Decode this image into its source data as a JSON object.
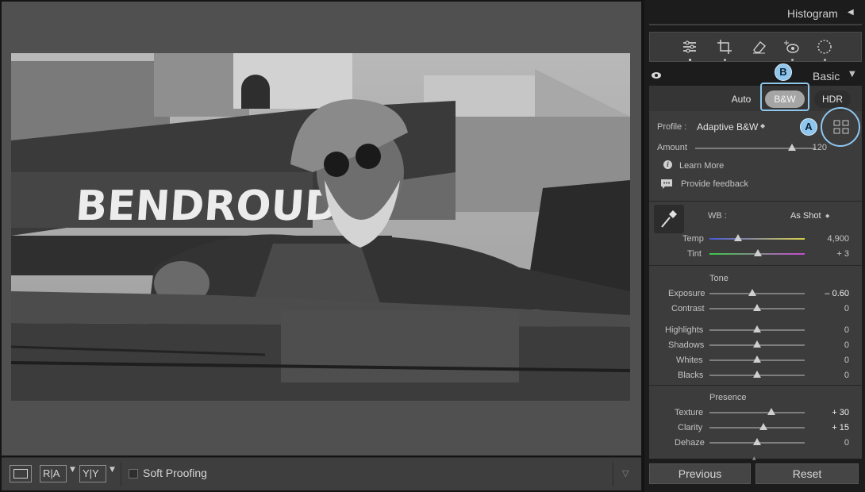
{
  "photo": {
    "sign_text": "BENDROUD"
  },
  "toolbar": {
    "loupe_icon": "loupe-view-icon",
    "ra_label": "R|A",
    "yy_label": "Y|Y",
    "soft_proofing_label": "Soft Proofing",
    "toolbar_menu_icon": "chevron-down-icon"
  },
  "panel": {
    "histogram_title": "Histogram",
    "tools": [
      "sliders-icon",
      "crop-icon",
      "eraser-icon",
      "redeye-icon",
      "mask-icon"
    ],
    "basic_title": "Basic",
    "treatment": {
      "auto_label": "Auto",
      "bw_label": "B&W",
      "hdr_label": "HDR"
    },
    "callouts": {
      "a": "A",
      "b": "B"
    },
    "profile": {
      "label": "Profile :",
      "value": "Adaptive B&W",
      "amount_label": "Amount",
      "amount_value": "120",
      "amount_pct": 80
    },
    "learn_more": "Learn More",
    "provide_feedback": "Provide feedback",
    "wb": {
      "label": "WB :",
      "value": "As Shot"
    },
    "temp": {
      "label": "Temp",
      "value": "4,900",
      "pct": 30
    },
    "tint": {
      "label": "Tint",
      "value": "+ 3",
      "pct": 51
    },
    "tone_header": "Tone",
    "exposure": {
      "label": "Exposure",
      "value": "– 0.60",
      "pct": 45
    },
    "contrast": {
      "label": "Contrast",
      "value": "0",
      "pct": 50
    },
    "highlights": {
      "label": "Highlights",
      "value": "0",
      "pct": 50
    },
    "shadows": {
      "label": "Shadows",
      "value": "0",
      "pct": 50
    },
    "whites": {
      "label": "Whites",
      "value": "0",
      "pct": 50
    },
    "blacks": {
      "label": "Blacks",
      "value": "0",
      "pct": 50
    },
    "presence_header": "Presence",
    "texture": {
      "label": "Texture",
      "value": "+ 30",
      "pct": 65
    },
    "clarity": {
      "label": "Clarity",
      "value": "+ 15",
      "pct": 57
    },
    "dehaze": {
      "label": "Dehaze",
      "value": "0",
      "pct": 50
    },
    "previous_label": "Previous",
    "reset_label": "Reset"
  },
  "colors": {
    "accent": "#8ec6ee",
    "panel_bg": "#3c3c3c",
    "canvas_bg": "#505050"
  }
}
